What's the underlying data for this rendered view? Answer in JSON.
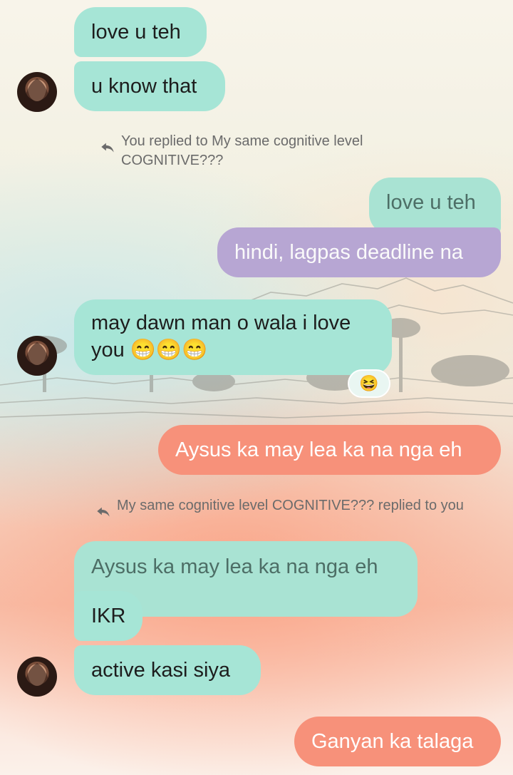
{
  "messages": [
    {
      "text": "love u teh"
    },
    {
      "text": "u know that"
    },
    {
      "reply_note": "You replied to My same cognitive level COGNITIVE???"
    },
    {
      "text": "love u teh"
    },
    {
      "text": "hindi, lagpas deadline na"
    },
    {
      "text": "may dawn man o wala i love you 😁😁😁",
      "reaction": "😆"
    },
    {
      "text": "Aysus ka may lea ka na nga eh"
    },
    {
      "reply_note": "My same cognitive level COGNITIVE??? replied to you"
    },
    {
      "text": "Aysus ka may lea ka na nga eh"
    },
    {
      "text": "IKR"
    },
    {
      "text": "active kasi siya"
    },
    {
      "text": "Ganyan ka talaga"
    }
  ],
  "icons": {
    "reply": "reply-arrow-icon",
    "avatar": "contact-avatar"
  },
  "colors": {
    "incoming": "#a6e5d6",
    "outgoing_purple": "#b7a6d3",
    "outgoing_coral": "#f7917a"
  }
}
